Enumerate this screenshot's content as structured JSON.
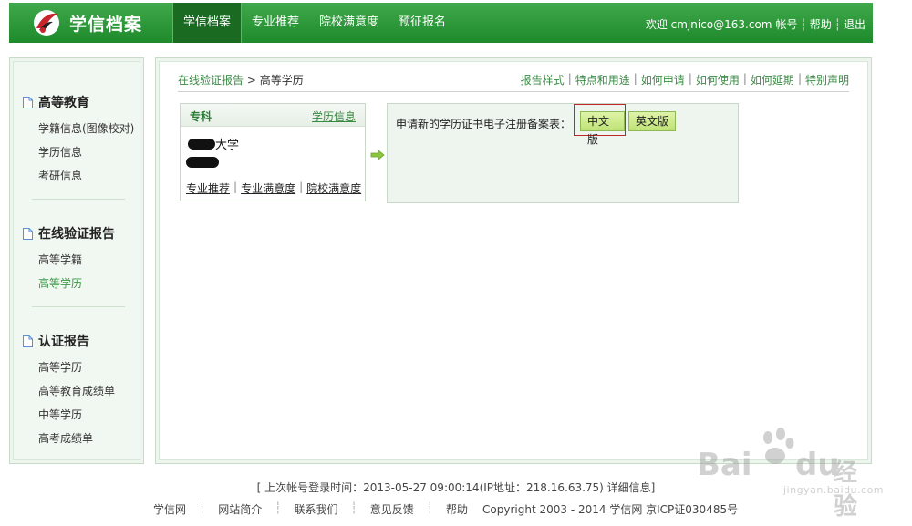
{
  "header": {
    "logo_text": "学信档案",
    "nav": [
      "学信档案",
      "专业推荐",
      "院校满意度",
      "预征报名"
    ],
    "active_nav": 0,
    "user": {
      "welcome": "欢迎 cmjnico@163.com",
      "account": "帐号",
      "help": "帮助",
      "logout": "退出"
    }
  },
  "sidebar": {
    "groups": [
      {
        "title": "高等教育",
        "icon": "document-icon",
        "items": [
          "学籍信息(图像校对)",
          "学历信息",
          "考研信息"
        ]
      },
      {
        "title": "在线验证报告",
        "icon": "document-icon",
        "items": [
          "高等学籍",
          "高等学历"
        ],
        "active_item": "高等学历"
      },
      {
        "title": "认证报告",
        "icon": "document-icon",
        "items": [
          "高等学历",
          "高等教育成绩单",
          "中等学历",
          "高考成绩单"
        ]
      }
    ]
  },
  "main": {
    "breadcrumb": {
      "link": "在线验证报告",
      "separator": ">",
      "current": "高等学历"
    },
    "top_links": [
      "报告样式",
      "特点和用途",
      "如何申请",
      "如何使用",
      "如何延期",
      "特别声明"
    ],
    "card": {
      "level": "专科",
      "info_link": "学历信息",
      "school_suffix": "大学",
      "links": [
        "专业推荐",
        "专业满意度",
        "院校满意度"
      ]
    },
    "apply": {
      "label": "申请新的学历证书电子注册备案表：",
      "btn_cn": "中文版",
      "btn_en": "英文版"
    }
  },
  "footer": {
    "last_login": "[ 上次帐号登录时间：2013-05-27 09:00:14(IP地址：218.16.63.75)    详细信息]",
    "links": [
      "学信网",
      "网站简介",
      "联系我们",
      "意见反馈",
      "帮助"
    ],
    "copyright": "Copyright 2003 - 2014 学信网 京ICP证030485号"
  },
  "watermark": {
    "brand": "Bai",
    "brand2": "du",
    "cn": "经验",
    "url": "jingyan.baidu.com"
  },
  "colors": {
    "header_green": "#2a9a38",
    "link_green": "#3a8a44",
    "button_green": "#c6e683",
    "highlight_red": "#c0282c"
  }
}
